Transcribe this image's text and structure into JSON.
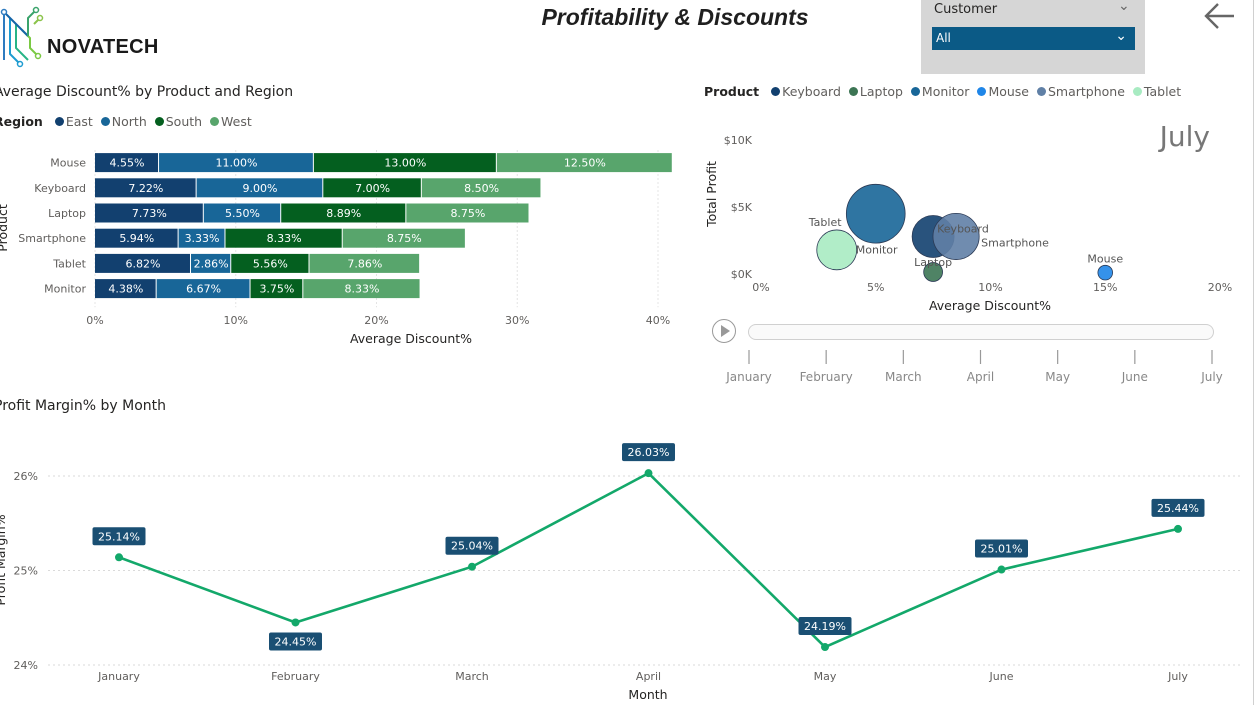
{
  "header": {
    "logo_text": "NOVATECH",
    "title": "Profitability & Discounts"
  },
  "slicer": {
    "label": "Customer",
    "value": "All"
  },
  "icons": {
    "back": "back-arrow-icon",
    "play": "play-icon",
    "logo": "circuit-logo-icon",
    "chevron": "chevron-down-icon"
  },
  "colors": {
    "east": "#12406f",
    "north": "#186698",
    "south": "#045f1f",
    "west": "#58a56c",
    "keyboard": "#12406f",
    "laptop": "#3c7554",
    "monitor": "#186698",
    "mouse": "#1f86e8",
    "smartphone": "#6080a6",
    "tablet": "#a8ebc2",
    "line": "#13a86a",
    "data_label_bg": "#1a4f73",
    "slicer_bg": "#0b5a86"
  },
  "chart_data": [
    {
      "type": "bar",
      "orientation": "horizontal",
      "stacked": true,
      "title": "Average Discount% by Product and Region",
      "legend_title": "Region",
      "legend_position": "top-left",
      "xlabel": "Average Discount%",
      "ylabel": "Product",
      "xlim": [
        0,
        40
      ],
      "x_ticks": [
        "0%",
        "10%",
        "20%",
        "30%",
        "40%"
      ],
      "grid": true,
      "categories": [
        "Mouse",
        "Keyboard",
        "Laptop",
        "Smartphone",
        "Tablet",
        "Monitor"
      ],
      "series": [
        {
          "name": "East",
          "values": [
            4.55,
            7.22,
            7.73,
            5.94,
            6.82,
            4.38
          ]
        },
        {
          "name": "North",
          "values": [
            11.0,
            9.0,
            5.5,
            3.33,
            2.86,
            6.67
          ]
        },
        {
          "name": "South",
          "values": [
            13.0,
            7.0,
            8.89,
            8.33,
            5.56,
            3.75
          ]
        },
        {
          "name": "West",
          "values": [
            12.5,
            8.5,
            8.75,
            8.75,
            7.86,
            8.33
          ]
        }
      ],
      "data_labels": [
        [
          "4.55%",
          "11.00%",
          "13.00%",
          "12.50%"
        ],
        [
          "7.22%",
          "9.00%",
          "7.00%",
          "8.50%"
        ],
        [
          "7.73%",
          "5.50%",
          "8.89%",
          "8.75%"
        ],
        [
          "5.94%",
          "3.33%",
          "8.33%",
          "8.75%"
        ],
        [
          "6.82%",
          "2.86%",
          "5.56%",
          "7.86%"
        ],
        [
          "4.38%",
          "6.67%",
          "3.75%",
          "8.33%"
        ]
      ]
    },
    {
      "type": "scatter",
      "bubble": true,
      "legend_title": "Product",
      "legend_position": "top",
      "xlabel": "Average Discount%",
      "ylabel": "Total Profit",
      "xlim": [
        0,
        20
      ],
      "ylim": [
        0,
        10000
      ],
      "x_ticks": [
        "0%",
        "5%",
        "10%",
        "15%",
        "20%"
      ],
      "y_ticks": [
        "$0K",
        "$5K",
        "$10K"
      ],
      "play_axis_value": "July",
      "play_axis_labels": [
        "January",
        "February",
        "March",
        "April",
        "May",
        "June",
        "July"
      ],
      "points": [
        {
          "name": "Keyboard",
          "x": 7.5,
          "y": 2800,
          "size": 1.0,
          "label": "Keyboard"
        },
        {
          "name": "Laptop",
          "x": 7.5,
          "y": 150,
          "size": 0.45,
          "label": "Laptop"
        },
        {
          "name": "Monitor",
          "x": 5.0,
          "y": 4500,
          "size": 1.4,
          "label": "Monitor"
        },
        {
          "name": "Mouse",
          "x": 15.0,
          "y": 100,
          "size": 0.35,
          "label": "Mouse"
        },
        {
          "name": "Smartphone",
          "x": 8.5,
          "y": 2800,
          "size": 1.1,
          "label": "Smartphone"
        },
        {
          "name": "Tablet",
          "x": 3.3,
          "y": 1800,
          "size": 0.95,
          "label": "Tablet"
        }
      ]
    },
    {
      "type": "line",
      "title": "Profit Margin% by Month",
      "xlabel": "Month",
      "ylabel": "Profit Margin%",
      "ylim": [
        24,
        26.3
      ],
      "y_ticks": [
        "24%",
        "25%",
        "26%"
      ],
      "grid": true,
      "x": [
        "January",
        "February",
        "March",
        "April",
        "May",
        "June",
        "July"
      ],
      "values": [
        25.14,
        24.45,
        25.04,
        26.03,
        24.19,
        25.01,
        25.44
      ],
      "data_labels": [
        "25.14%",
        "24.45%",
        "25.04%",
        "26.03%",
        "24.19%",
        "25.01%",
        "25.44%"
      ]
    }
  ]
}
